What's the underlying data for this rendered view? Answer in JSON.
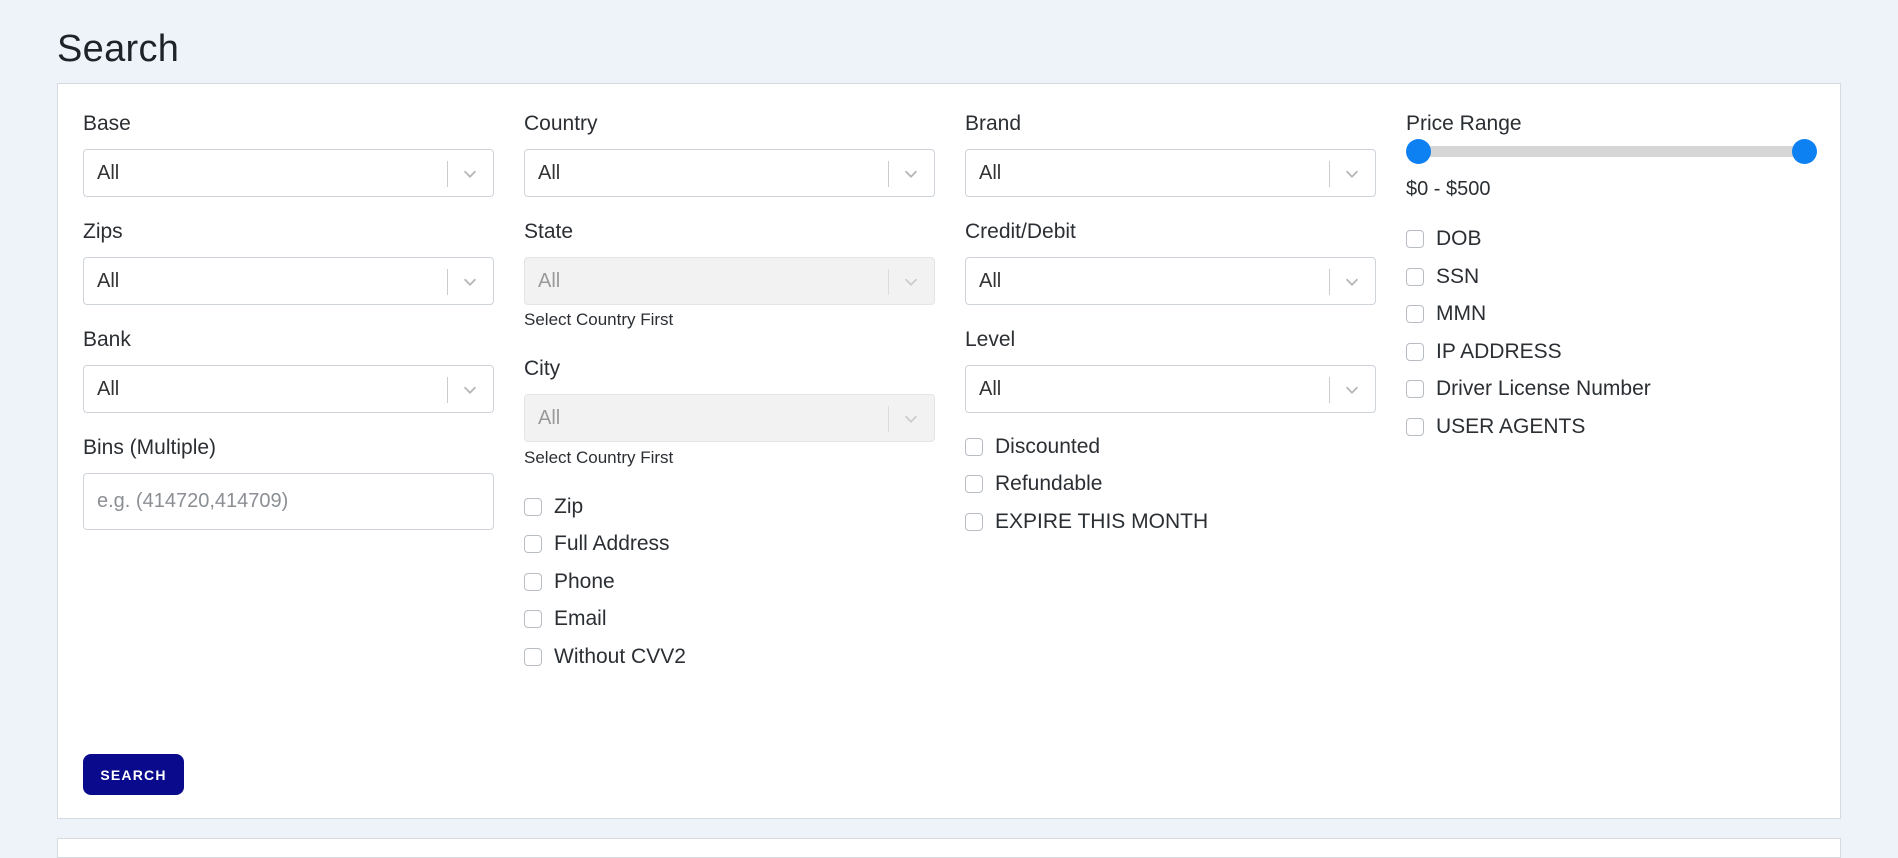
{
  "page": {
    "title": "Search"
  },
  "filters": {
    "base": {
      "label": "Base",
      "value": "All"
    },
    "zips": {
      "label": "Zips",
      "value": "All"
    },
    "bank": {
      "label": "Bank",
      "value": "All"
    },
    "bins": {
      "label": "Bins (Multiple)",
      "placeholder": "e.g. (414720,414709)"
    },
    "country": {
      "label": "Country",
      "value": "All"
    },
    "state": {
      "label": "State",
      "value": "All",
      "hint": "Select Country First"
    },
    "city": {
      "label": "City",
      "value": "All",
      "hint": "Select Country First"
    },
    "brand": {
      "label": "Brand",
      "value": "All"
    },
    "credit_debit": {
      "label": "Credit/Debit",
      "value": "All"
    },
    "level": {
      "label": "Level",
      "value": "All"
    },
    "price_range": {
      "label": "Price Range",
      "text": "$0 - $500",
      "min": 0,
      "max": 500
    }
  },
  "checkboxes": {
    "col2": [
      "Zip",
      "Full Address",
      "Phone",
      "Email",
      "Without CVV2"
    ],
    "col3": [
      "Discounted",
      "Refundable",
      "EXPIRE THIS MONTH"
    ],
    "col4": [
      "DOB",
      "SSN",
      "MMN",
      "IP ADDRESS",
      "Driver License Number",
      "USER AGENTS"
    ]
  },
  "actions": {
    "search_label": "SEARCH"
  },
  "colors": {
    "accent": "#0d80f2",
    "button": "#0a0a8c",
    "background": "#eef3fa"
  }
}
